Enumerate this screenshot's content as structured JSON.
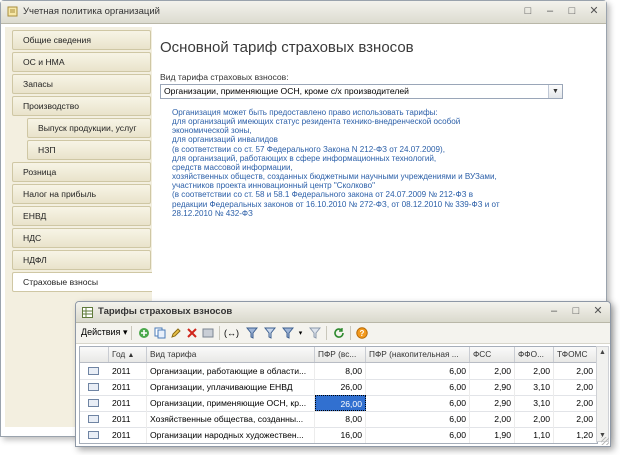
{
  "main_window": {
    "title": "Учетная политика организаций",
    "buttons": [
      "□",
      "–",
      "□",
      "✕"
    ]
  },
  "sidebar": {
    "items": [
      {
        "label": "Общие сведения"
      },
      {
        "label": "ОС и НМА"
      },
      {
        "label": "Запасы"
      },
      {
        "label": "Производство"
      },
      {
        "label": "Выпуск продукции, услуг"
      },
      {
        "label": "НЗП"
      },
      {
        "label": "Розница"
      },
      {
        "label": "Налог на прибыль"
      },
      {
        "label": "ЕНВД"
      },
      {
        "label": "НДС"
      },
      {
        "label": "НДФЛ"
      },
      {
        "label": "Страховые взносы"
      }
    ]
  },
  "content": {
    "title": "Основной тариф страховых взносов",
    "tariff_label": "Вид тарифа страховых взносов:",
    "tariff_value": "Организации, применяющие ОСН, кроме с/х производителей",
    "info_lines": [
      "Организация может быть предоставлено право использовать тарифы:",
      "для организаций имеющих статус резидента технико-внедренческой особой",
      "экономической зоны,",
      "для организаций инвалидов",
      "(в соответствии со ст. 57 Федерального Закона  N 212-ФЗ от 24.07.2009),",
      "для организаций, работающих в сфере информационных технологий,",
      "средств массовой информации,",
      "хозяйственных обществ, созданных бюджетными научными учреждениями и ВУЗами,",
      "участников проекта инновационный центр \"Сколково\"",
      "(в соответствии со ст. 58 и 58.1 Федерального закона от 24.07.2009 № 212-ФЗ в",
      "редакции Федеральных законов от 16.10.2010 № 272-ФЗ, от 08.12.2010 № 339-ФЗ и от",
      "28.12.2010 № 432-ФЗ"
    ]
  },
  "tariffs_window": {
    "title": "Тарифы страховых взносов",
    "buttons": [
      "–",
      "□",
      "✕"
    ],
    "actions_label": "Действия",
    "columns": [
      "Год",
      "Вид тарифа",
      "ПФР (вс...",
      "ПФР (накопительная ...",
      "ФСС",
      "ФФО...",
      "ТФОМС"
    ],
    "rows": [
      {
        "year": "2011",
        "tariff": "Организации, работающие в области...",
        "pfr_total": "8,00",
        "pfr_acc": "6,00",
        "fss": "2,00",
        "ffoms": "2,00",
        "tfoms": "2,00"
      },
      {
        "year": "2011",
        "tariff": "Организации, уплачивающие ЕНВД",
        "pfr_total": "26,00",
        "pfr_acc": "6,00",
        "fss": "2,90",
        "ffoms": "3,10",
        "tfoms": "2,00"
      },
      {
        "year": "2011",
        "tariff": "Организации, применяющие ОСН, кр...",
        "pfr_total": "26,00",
        "pfr_acc": "6,00",
        "fss": "2,90",
        "ffoms": "3,10",
        "tfoms": "2,00"
      },
      {
        "year": "2011",
        "tariff": "Хозяйственные общества, созданны...",
        "pfr_total": "8,00",
        "pfr_acc": "6,00",
        "fss": "2,00",
        "ffoms": "2,00",
        "tfoms": "2,00"
      },
      {
        "year": "2011",
        "tariff": "Организации народных художествен...",
        "pfr_total": "16,00",
        "pfr_acc": "6,00",
        "fss": "1,90",
        "ffoms": "1,10",
        "tfoms": "1,20"
      }
    ],
    "selected_row": 2
  }
}
